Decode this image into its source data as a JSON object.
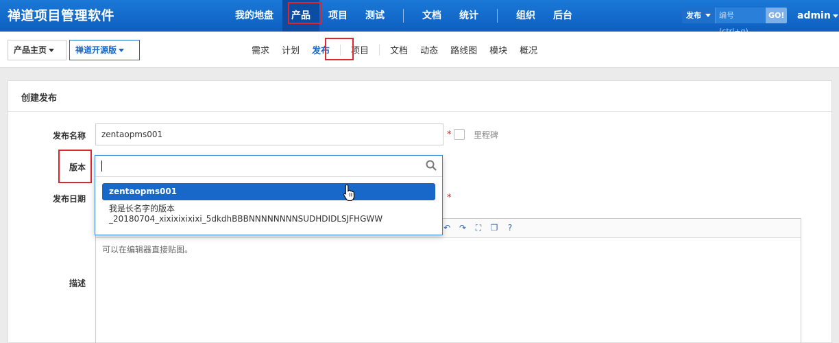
{
  "header": {
    "brand": "禅道项目管理软件",
    "nav": [
      {
        "label": "我的地盘",
        "active": false
      },
      {
        "label": "产品",
        "active": true
      },
      {
        "label": "项目",
        "active": false
      },
      {
        "label": "测试",
        "active": false
      },
      {
        "label": "文档",
        "active": false
      },
      {
        "label": "统计",
        "active": false
      },
      {
        "label": "组织",
        "active": false
      },
      {
        "label": "后台",
        "active": false
      }
    ],
    "search": {
      "type_label": "发布",
      "placeholder": "编号(ctrl+g)",
      "go_label": "GO!"
    },
    "user": "admin"
  },
  "breadcrumb": {
    "home": "产品主页",
    "product": "禅道开源版"
  },
  "subnav": [
    {
      "label": "需求",
      "active": false
    },
    {
      "label": "计划",
      "active": false
    },
    {
      "label": "发布",
      "active": true
    },
    {
      "label": "项目",
      "active": false
    },
    {
      "label": "文档",
      "active": false
    },
    {
      "label": "动态",
      "active": false
    },
    {
      "label": "路线图",
      "active": false
    },
    {
      "label": "模块",
      "active": false
    },
    {
      "label": "概况",
      "active": false
    }
  ],
  "form": {
    "title": "创建发布",
    "name_label": "发布名称",
    "name_value": "zentaopms001",
    "required_mark": "*",
    "milestone_label": "里程碑",
    "build_label": "版本",
    "date_label": "发布日期",
    "desc_label": "描述",
    "editor_placeholder": "可以在编辑器直接贴图。"
  },
  "dropdown": {
    "search_value": "",
    "options": [
      {
        "label": "zentaopms001",
        "highlighted": true
      },
      {
        "label": "我是长名字的版本",
        "label_line2": "_20180704_xixixixixixi_5dkdhBBBNNNNNNNNSUDHDIDLSJFHGWW",
        "highlighted": false
      }
    ]
  },
  "colors": {
    "header": "#0d5fc0",
    "accent": "#1768c8",
    "annotation": "#e0262b",
    "required": "#e02020"
  }
}
